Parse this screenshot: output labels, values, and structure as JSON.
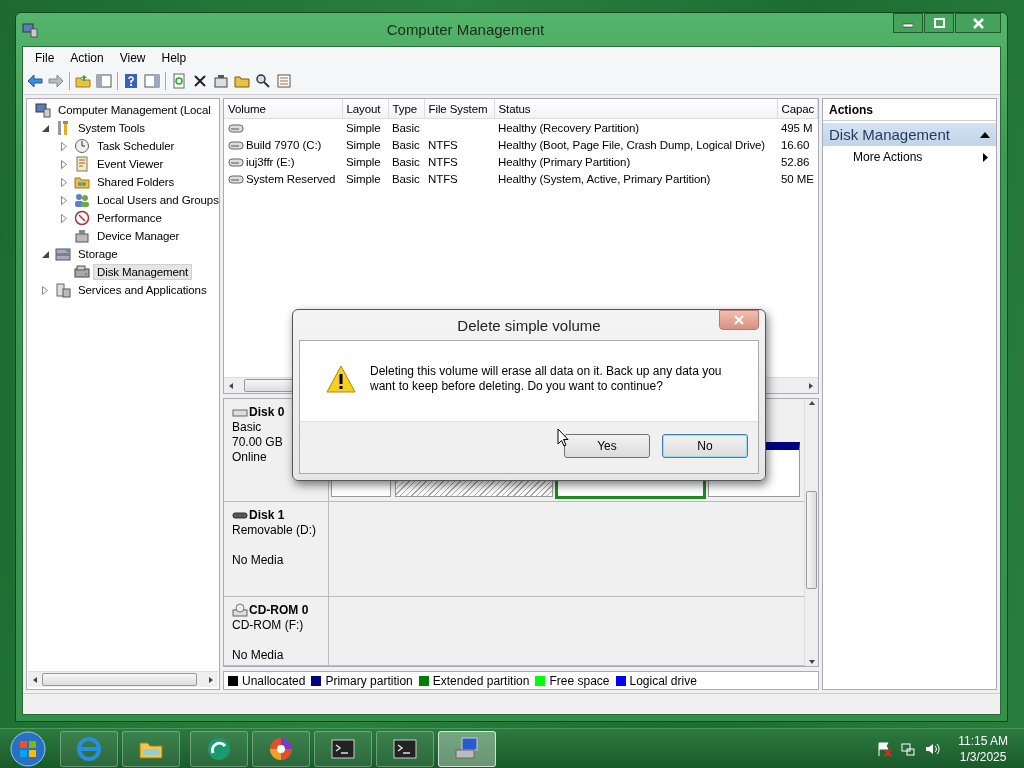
{
  "window": {
    "title": "Computer Management"
  },
  "menu": [
    "File",
    "Action",
    "View",
    "Help"
  ],
  "tree": [
    {
      "label": "Computer Management (Local",
      "selected": false,
      "children": [
        {
          "label": "System Tools",
          "expanded": true,
          "selected": false,
          "children": [
            {
              "label": "Task Scheduler",
              "expanded": false,
              "selected": false
            },
            {
              "label": "Event Viewer",
              "expanded": false,
              "selected": false
            },
            {
              "label": "Shared Folders",
              "expanded": false,
              "selected": false
            },
            {
              "label": "Local Users and Groups",
              "expanded": false,
              "selected": false
            },
            {
              "label": "Performance",
              "expanded": false,
              "selected": false
            },
            {
              "label": "Device Manager",
              "selected": false
            }
          ]
        },
        {
          "label": "Storage",
          "expanded": true,
          "selected": false,
          "children": [
            {
              "label": "Disk Management",
              "selected": true
            }
          ]
        },
        {
          "label": "Services and Applications",
          "expanded": false,
          "selected": false
        }
      ]
    }
  ],
  "table": {
    "columns": [
      "Volume",
      "Layout",
      "Type",
      "File System",
      "Status",
      "Capac"
    ],
    "rows": [
      [
        "",
        "Simple",
        "Basic",
        "",
        "Healthy (Recovery Partition)",
        "495 M"
      ],
      [
        "Build 7970 (C:)",
        "Simple",
        "Basic",
        "NTFS",
        "Healthy (Boot, Page File, Crash Dump, Logical Drive)",
        "16.60"
      ],
      [
        "iuj3ffr (E:)",
        "Simple",
        "Basic",
        "NTFS",
        "Healthy (Primary Partition)",
        "52.86"
      ],
      [
        "System Reserved",
        "Simple",
        "Basic",
        "NTFS",
        "Healthy (System, Active, Primary Partition)",
        "50 ME"
      ]
    ]
  },
  "disks": [
    {
      "kind": "hdd",
      "name": "Disk 0",
      "type": "Basic",
      "size": "70.00 GB",
      "status": "Online",
      "partitions": [
        {
          "kind": "plain",
          "selected": false
        },
        {
          "kind": "striped",
          "selected": false
        },
        {
          "kind": "plain",
          "selected": true
        },
        {
          "kind": "plain",
          "selected": false
        }
      ]
    },
    {
      "kind": "removable",
      "name": "Disk 1",
      "type": "Removable (D:)",
      "status": "No Media"
    },
    {
      "kind": "cdrom",
      "name": "CD-ROM 0",
      "type": "CD-ROM (F:)",
      "status": "No Media"
    }
  ],
  "legend": [
    {
      "label": "Unallocated",
      "color": "#000000"
    },
    {
      "label": "Primary partition",
      "color": "#000080"
    },
    {
      "label": "Extended partition",
      "color": "#008000"
    },
    {
      "label": "Free space",
      "color": "#00ff00"
    },
    {
      "label": "Logical drive",
      "color": "#0000ff"
    }
  ],
  "actions": {
    "header": "Actions",
    "section": {
      "label": "Disk Management",
      "expanded": true
    },
    "items": [
      "More Actions"
    ]
  },
  "dialog": {
    "title": "Delete simple volume",
    "message": "Deleting this volume will erase all data on it. Back up any data you want to keep before deleting. Do you want to continue?",
    "buttons": [
      {
        "label": "Yes",
        "default": false
      },
      {
        "label": "No",
        "default": true
      }
    ]
  },
  "taskbar": {
    "buttons": [
      {
        "active": false
      },
      {
        "active": false
      },
      {
        "active": false
      },
      {
        "active": false
      },
      {
        "active": false
      },
      {
        "active": false
      },
      {
        "active": true
      }
    ],
    "time": "11:15 AM",
    "date": "1/3/2025"
  }
}
